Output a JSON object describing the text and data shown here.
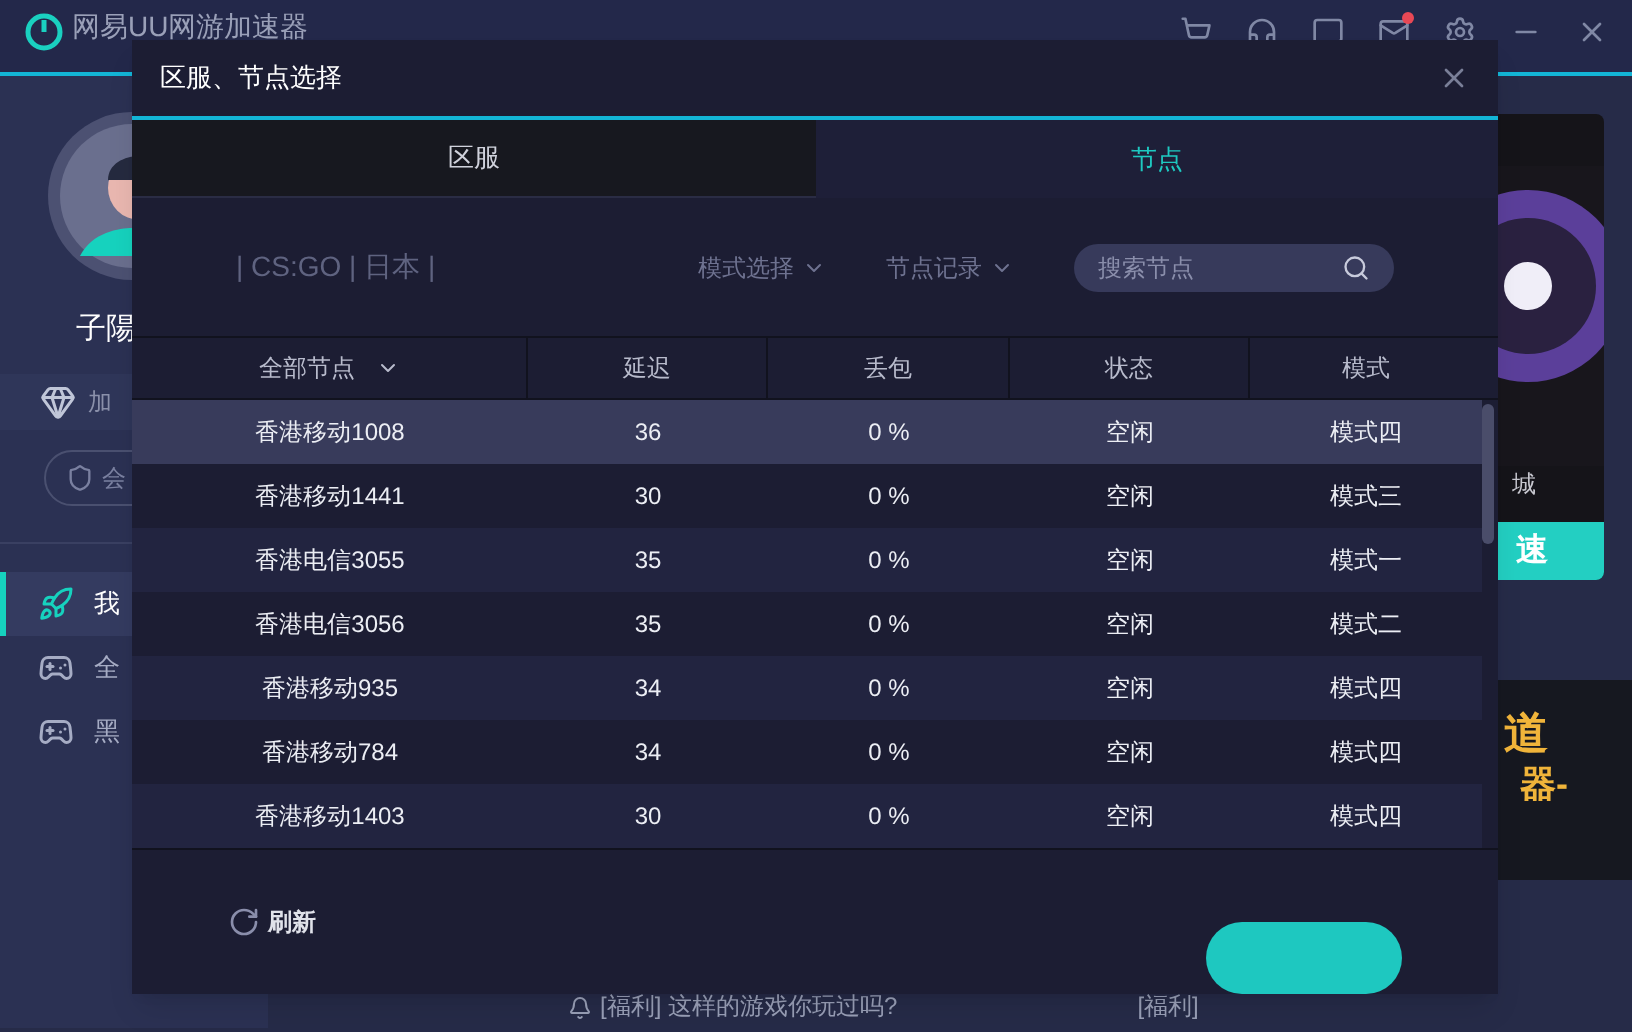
{
  "app": {
    "title": "网易UU网游加速器",
    "mail_unread": true,
    "user_name": "子陽",
    "vip_label": "加",
    "member_label": "会",
    "sidebar_items": [
      {
        "label": "我",
        "selected": true
      },
      {
        "label": "全",
        "selected": false
      },
      {
        "label": "黑",
        "selected": false
      }
    ],
    "store_label": "城",
    "boost_label": "速",
    "banner_lines": [
      "道",
      "器-"
    ],
    "news": [
      "[福利] 这样的游戏你玩过吗?",
      "[福利]"
    ]
  },
  "dialog": {
    "title": "区服、节点选择",
    "tabs": [
      {
        "label": "区服",
        "selected": false
      },
      {
        "label": "节点",
        "selected": true
      }
    ],
    "breadcrumb": "| CS:GO | 日本 |",
    "filters": [
      "模式选择",
      "节点记录"
    ],
    "search": {
      "placeholder": "搜索节点"
    },
    "table": {
      "columns": [
        "全部节点",
        "延迟",
        "丢包",
        "状态",
        "模式"
      ],
      "rows": [
        {
          "cells": [
            "香港移动1008",
            "36",
            "0 %",
            "空闲",
            "模式四"
          ],
          "selected": true
        },
        {
          "cells": [
            "香港移动1441",
            "30",
            "0 %",
            "空闲",
            "模式三"
          ],
          "selected": false
        },
        {
          "cells": [
            "香港电信3055",
            "35",
            "0 %",
            "空闲",
            "模式一"
          ],
          "selected": false
        },
        {
          "cells": [
            "香港电信3056",
            "35",
            "0 %",
            "空闲",
            "模式二"
          ],
          "selected": false
        },
        {
          "cells": [
            "香港移动935",
            "34",
            "0 %",
            "空闲",
            "模式四"
          ],
          "selected": false
        },
        {
          "cells": [
            "香港移动784",
            "34",
            "0 %",
            "空闲",
            "模式四"
          ],
          "selected": false
        },
        {
          "cells": [
            "香港移动1403",
            "30",
            "0 %",
            "空闲",
            "模式四"
          ],
          "selected": false
        }
      ]
    },
    "refresh": "刷新"
  }
}
